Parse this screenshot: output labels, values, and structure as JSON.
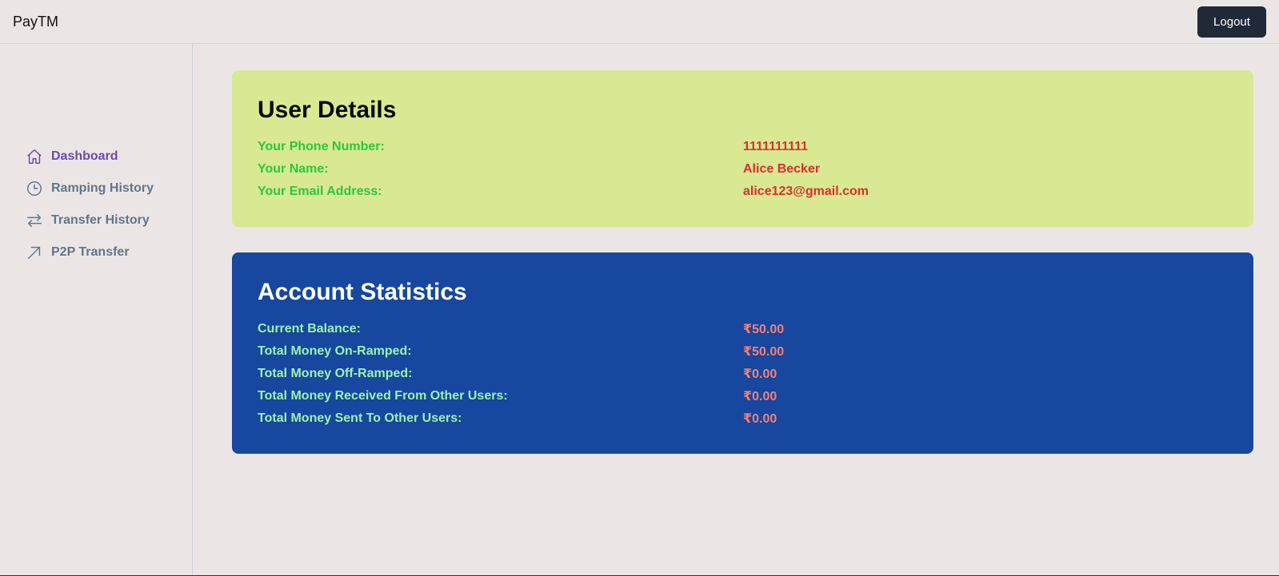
{
  "header": {
    "brand": "PayTM",
    "logout_label": "Logout"
  },
  "sidebar": {
    "items": [
      {
        "label": "Dashboard",
        "icon": "home-icon",
        "active": true
      },
      {
        "label": "Ramping History",
        "icon": "clock-icon",
        "active": false
      },
      {
        "label": "Transfer History",
        "icon": "transfer-arrows-icon",
        "active": false
      },
      {
        "label": "P2P Transfer",
        "icon": "arrow-up-right-icon",
        "active": false
      }
    ]
  },
  "user_details": {
    "title": "User Details",
    "rows": [
      {
        "label": "Your Phone Number:",
        "value": "1111111111"
      },
      {
        "label": "Your Name:",
        "value": "Alice Becker"
      },
      {
        "label": "Your Email Address:",
        "value": "alice123@gmail.com"
      }
    ]
  },
  "account_stats": {
    "title": "Account Statistics",
    "rows": [
      {
        "label": "Current Balance:",
        "value": "₹50.00"
      },
      {
        "label": "Total Money On-Ramped:",
        "value": "₹50.00"
      },
      {
        "label": "Total Money Off-Ramped:",
        "value": "₹0.00"
      },
      {
        "label": "Total Money Received From Other Users:",
        "value": "₹0.00"
      },
      {
        "label": "Total Money Sent To Other Users:",
        "value": "₹0.00"
      }
    ]
  },
  "colors": {
    "background": "#ebe6e5",
    "user_card": "#d9e893",
    "stats_card": "#17479e",
    "active_nav": "#6d4aa8",
    "logout_button": "#1f2937"
  }
}
